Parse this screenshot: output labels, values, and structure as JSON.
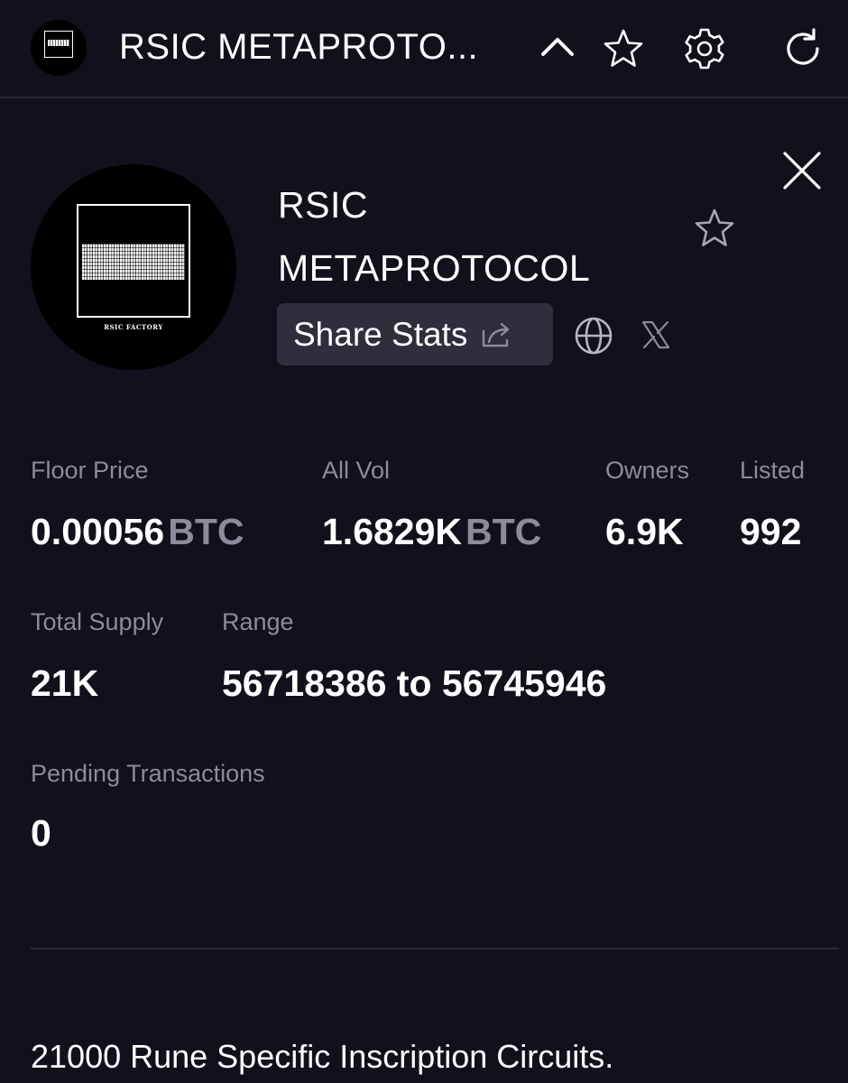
{
  "topbar": {
    "title": "RSIC METAPROTO...",
    "icons": [
      "chevron-up-icon",
      "star-icon",
      "gear-icon",
      "refresh-icon"
    ]
  },
  "collection": {
    "name_line1": "RSIC",
    "name_line2": "METAPROTOCOL",
    "logo_caption": "RSIC FACTORY",
    "share_label": "Share Stats",
    "links": [
      "globe-icon",
      "x-icon"
    ]
  },
  "stats": {
    "floor_price": {
      "label": "Floor Price",
      "value": "0.00056",
      "unit": "BTC"
    },
    "all_vol": {
      "label": "All Vol",
      "value": "1.6829K",
      "unit": "BTC"
    },
    "owners": {
      "label": "Owners",
      "value": "6.9K"
    },
    "listed": {
      "label": "Listed",
      "value": "992"
    },
    "total_supply": {
      "label": "Total Supply",
      "value": "21K"
    },
    "range": {
      "label": "Range",
      "value": "56718386 to 56745946"
    },
    "pending": {
      "label": "Pending Transactions",
      "value": "0"
    }
  },
  "description": "21000 Rune Specific Inscription Circuits.",
  "colors": {
    "background": "#13101b",
    "muted_text": "#8e8a9a",
    "button_bg": "#302d3d",
    "divider": "#2a2733"
  }
}
